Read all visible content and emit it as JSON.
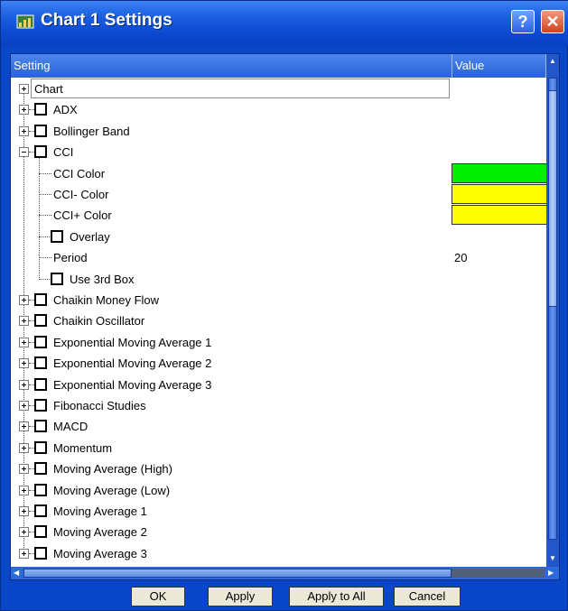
{
  "window": {
    "title": "Chart 1 Settings",
    "help_label": "?",
    "close_label": "✕"
  },
  "columns": {
    "setting": "Setting",
    "value": "Value"
  },
  "colors": {
    "green": "#00ee00",
    "yellow": "#ffff00"
  },
  "tree": [
    {
      "label": "Chart",
      "level": 0,
      "expander": "plus",
      "checkbox": false
    },
    {
      "label": "ADX",
      "level": 0,
      "expander": "plus",
      "checkbox": true
    },
    {
      "label": "Bollinger Band",
      "level": 0,
      "expander": "plus",
      "checkbox": true
    },
    {
      "label": "CCI",
      "level": 0,
      "expander": "minus",
      "checkbox": true
    },
    {
      "label": "CCI Color",
      "level": 1,
      "checkbox": false,
      "swatch": "#00ee00"
    },
    {
      "label": "CCI- Color",
      "level": 1,
      "checkbox": false,
      "swatch": "#ffff00"
    },
    {
      "label": "CCI+ Color",
      "level": 1,
      "checkbox": false,
      "swatch": "#ffff00"
    },
    {
      "label": "Overlay",
      "level": 1,
      "checkbox": true
    },
    {
      "label": "Period",
      "level": 1,
      "checkbox": false,
      "value": "20"
    },
    {
      "label": "Use 3rd Box",
      "level": 1,
      "checkbox": true
    },
    {
      "label": "Chaikin Money Flow",
      "level": 0,
      "expander": "plus",
      "checkbox": true
    },
    {
      "label": "Chaikin Oscillator",
      "level": 0,
      "expander": "plus",
      "checkbox": true
    },
    {
      "label": "Exponential Moving Average 1",
      "level": 0,
      "expander": "plus",
      "checkbox": true
    },
    {
      "label": "Exponential Moving Average 2",
      "level": 0,
      "expander": "plus",
      "checkbox": true
    },
    {
      "label": "Exponential Moving Average 3",
      "level": 0,
      "expander": "plus",
      "checkbox": true
    },
    {
      "label": "Fibonacci Studies",
      "level": 0,
      "expander": "plus",
      "checkbox": true
    },
    {
      "label": "MACD",
      "level": 0,
      "expander": "plus",
      "checkbox": true
    },
    {
      "label": "Momentum",
      "level": 0,
      "expander": "plus",
      "checkbox": true
    },
    {
      "label": "Moving Average (High)",
      "level": 0,
      "expander": "plus",
      "checkbox": true
    },
    {
      "label": "Moving Average (Low)",
      "level": 0,
      "expander": "plus",
      "checkbox": true
    },
    {
      "label": "Moving Average 1",
      "level": 0,
      "expander": "plus",
      "checkbox": true
    },
    {
      "label": "Moving Average 2",
      "level": 0,
      "expander": "plus",
      "checkbox": true
    },
    {
      "label": "Moving Average 3",
      "level": 0,
      "expander": "plus",
      "checkbox": true
    }
  ],
  "buttons": {
    "ok": "OK",
    "apply": "Apply",
    "apply_all": "Apply to All",
    "cancel": "Cancel"
  }
}
